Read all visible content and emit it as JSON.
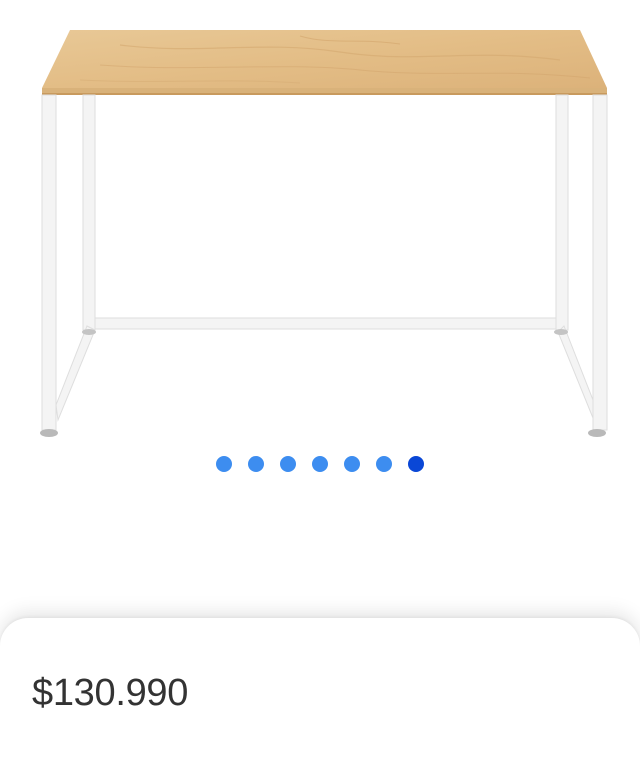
{
  "product": {
    "image_description_icon": "desk-image",
    "price": "$130.990"
  },
  "carousel": {
    "total_images": 7,
    "active_index": 6
  },
  "colors": {
    "dot": "#3d8df0",
    "dot_active": "#0a47d6",
    "price_text": "#333333"
  }
}
